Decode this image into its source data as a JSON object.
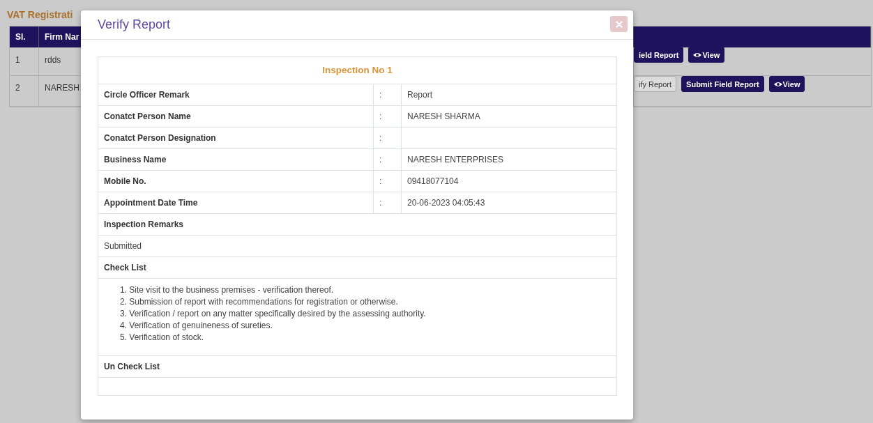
{
  "background": {
    "heading": "VAT Registrati",
    "columns": [
      "Sl.",
      "Firm Nar"
    ],
    "rows": [
      {
        "sl": "1",
        "firm": "rdds",
        "actions": [
          {
            "label": "ield Report",
            "kind": "primary"
          },
          {
            "label": "View",
            "kind": "view"
          }
        ]
      },
      {
        "sl": "2",
        "firm": "NARESH",
        "actions": [
          {
            "label": "ify Report",
            "kind": "light"
          },
          {
            "label": "Submit Field Report",
            "kind": "primary"
          },
          {
            "label": "View",
            "kind": "view"
          }
        ]
      }
    ]
  },
  "modal": {
    "title": "Verify Report",
    "inspection_title": "Inspection No 1",
    "fields": [
      {
        "label": "Circle Officer Remark",
        "value": "Report"
      },
      {
        "label": "Conatct Person Name",
        "value": "NARESH SHARMA"
      },
      {
        "label": "Conatct Person Designation"
      },
      {
        "label": "Business Name",
        "value": "NARESH ENTERPRISES"
      },
      {
        "label": "Mobile No.",
        "value": "09418077104"
      },
      {
        "label": "Appointment Date Time",
        "value": "20-06-2023 04:05:43"
      }
    ],
    "separator": ":",
    "sections": [
      {
        "heading": "Inspection Remarks",
        "kind": "text",
        "text": "Submitted"
      },
      {
        "heading": "Check List",
        "kind": "list",
        "items": [
          "1. Site visit to the business premises - verification thereof.",
          "2. Submission of report with recommendations for registration or otherwise.",
          "3. Verification / report on any matter specifically desired by the assessing authority.",
          "4. Verification of genuineness of sureties.",
          "5. Verification of stock."
        ]
      },
      {
        "heading": "Un Check List",
        "kind": "empty"
      }
    ]
  }
}
